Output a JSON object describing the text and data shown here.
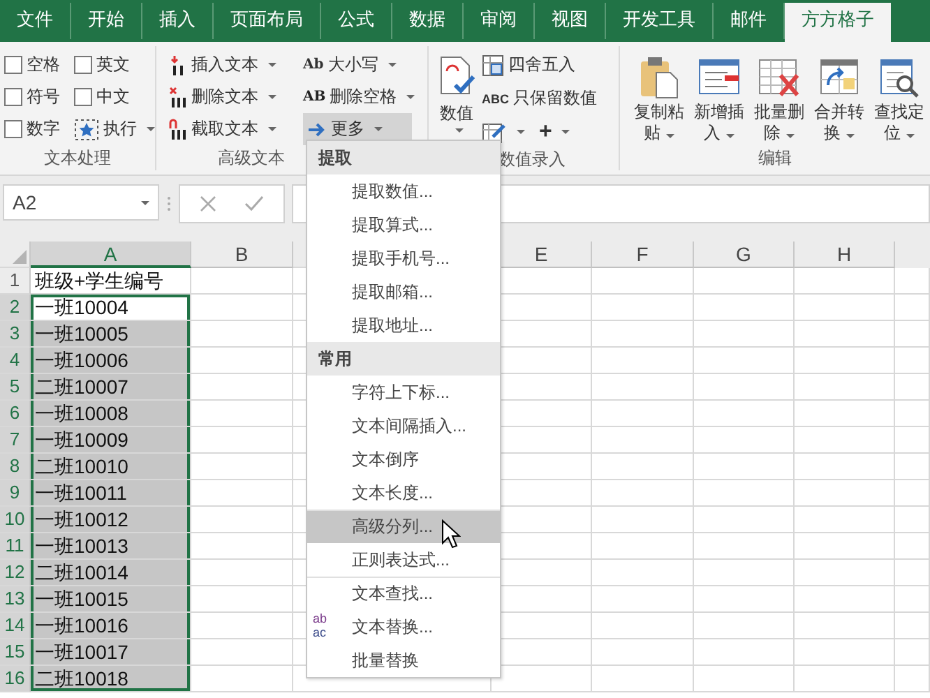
{
  "tabs": [
    {
      "label": "文件",
      "selected": false
    },
    {
      "label": "开始",
      "selected": false
    },
    {
      "label": "插入",
      "selected": false
    },
    {
      "label": "页面布局",
      "selected": false
    },
    {
      "label": "公式",
      "selected": false
    },
    {
      "label": "数据",
      "selected": false
    },
    {
      "label": "审阅",
      "selected": false
    },
    {
      "label": "视图",
      "selected": false
    },
    {
      "label": "开发工具",
      "selected": false
    },
    {
      "label": "邮件",
      "selected": false
    },
    {
      "label": "方方格子",
      "selected": true
    }
  ],
  "ribbon": {
    "groups": [
      {
        "kind": "checks",
        "label": "文本处理",
        "checkboxes": [
          {
            "label": "空格",
            "checked": false
          },
          {
            "label": "英文",
            "checked": false
          },
          {
            "label": "符号",
            "checked": false
          },
          {
            "label": "中文",
            "checked": false
          },
          {
            "label": "数字",
            "checked": false
          }
        ],
        "run_button": {
          "label": "执行"
        }
      },
      {
        "kind": "commands",
        "label": "高级文本",
        "commands": [
          {
            "kind": "insert",
            "label": "插入文本",
            "pressed": false
          },
          {
            "kind": "case",
            "icon_text": "Ab",
            "label": "大小写",
            "pressed": false
          },
          {
            "kind": "delete",
            "label": "删除文本",
            "pressed": false
          },
          {
            "kind": "trim",
            "icon_text": "AB",
            "label": "删除空格",
            "pressed": false
          },
          {
            "kind": "cut",
            "label": "截取文本",
            "pressed": false
          },
          {
            "kind": "more",
            "label": "更多",
            "pressed": true
          }
        ]
      },
      {
        "kind": "numbers",
        "label": "数值录入",
        "big_button": {
          "label": "数值"
        },
        "commands": [
          {
            "kind": "round",
            "label": "四舍五入"
          },
          {
            "kind": "keep",
            "icon_text": "ABC",
            "label": "只保留数值"
          }
        ],
        "plus_button": {
          "label": "+"
        }
      },
      {
        "kind": "big",
        "label": "编辑",
        "buttons": [
          {
            "kind": "paste",
            "label": "复制粘贴"
          },
          {
            "kind": "add",
            "label": "新增插入"
          },
          {
            "kind": "remove",
            "label": "批量删除"
          },
          {
            "kind": "merge",
            "label": "合并转换"
          },
          {
            "kind": "find",
            "label": "查找定位"
          }
        ]
      }
    ]
  },
  "formula_bar": {
    "name_box": "A2"
  },
  "sheet": {
    "columns": [
      {
        "label": "A",
        "selected": true
      },
      {
        "label": "B",
        "selected": false
      },
      {
        "label": "E",
        "selected": false
      },
      {
        "label": "F",
        "selected": false
      },
      {
        "label": "G",
        "selected": false
      },
      {
        "label": "H",
        "selected": false
      }
    ],
    "rows": [
      {
        "number": "1",
        "value": "班级+学生编号",
        "selected": false,
        "active": false
      },
      {
        "number": "2",
        "value": "一班10004",
        "selected": true,
        "active": true
      },
      {
        "number": "3",
        "value": "一班10005",
        "selected": true,
        "active": false
      },
      {
        "number": "4",
        "value": "一班10006",
        "selected": true,
        "active": false
      },
      {
        "number": "5",
        "value": "二班10007",
        "selected": true,
        "active": false
      },
      {
        "number": "6",
        "value": "一班10008",
        "selected": true,
        "active": false
      },
      {
        "number": "7",
        "value": "一班10009",
        "selected": true,
        "active": false
      },
      {
        "number": "8",
        "value": "二班10010",
        "selected": true,
        "active": false
      },
      {
        "number": "9",
        "value": "一班10011",
        "selected": true,
        "active": false
      },
      {
        "number": "10",
        "value": "一班10012",
        "selected": true,
        "active": false
      },
      {
        "number": "11",
        "value": "一班10013",
        "selected": true,
        "active": false
      },
      {
        "number": "12",
        "value": "二班10014",
        "selected": true,
        "active": false
      },
      {
        "number": "13",
        "value": "一班10015",
        "selected": true,
        "active": false
      },
      {
        "number": "14",
        "value": "一班10016",
        "selected": true,
        "active": false
      },
      {
        "number": "15",
        "value": "一班10017",
        "selected": true,
        "active": false
      },
      {
        "number": "16",
        "value": "二班10018",
        "selected": true,
        "active": false
      }
    ]
  },
  "menu": {
    "sections": [
      {
        "title": "提取",
        "items": [
          {
            "label": "提取数值...",
            "selected": false,
            "separator": false
          },
          {
            "label": "提取算式...",
            "selected": false,
            "separator": false
          },
          {
            "label": "提取手机号...",
            "selected": false,
            "separator": false
          },
          {
            "label": "提取邮箱...",
            "selected": false,
            "separator": false
          },
          {
            "label": "提取地址...",
            "selected": false,
            "separator": false
          }
        ]
      },
      {
        "title": "常用",
        "items": [
          {
            "label": "字符上下标...",
            "selected": false,
            "separator": false
          },
          {
            "label": "文本间隔插入...",
            "selected": false,
            "separator": false
          },
          {
            "label": "文本倒序",
            "selected": false,
            "separator": false
          },
          {
            "label": "文本长度...",
            "selected": false,
            "separator": false
          },
          {
            "label": "高级分列...",
            "selected": true,
            "separator": true
          },
          {
            "label": "正则表达式...",
            "selected": false,
            "separator": false
          },
          {
            "label": "文本查找...",
            "selected": false,
            "separator": true
          },
          {
            "label": "文本替换...",
            "selected": false,
            "separator": false,
            "icon_lines": [
              "ab",
              "ac"
            ]
          },
          {
            "label": "批量替换",
            "selected": false,
            "separator": false
          }
        ]
      }
    ]
  }
}
